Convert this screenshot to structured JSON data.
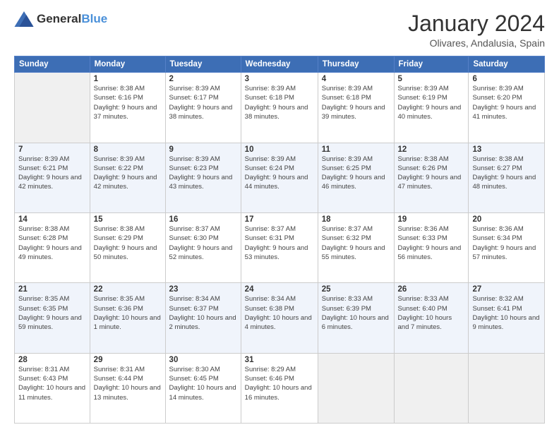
{
  "logo": {
    "general": "General",
    "blue": "Blue"
  },
  "header": {
    "month": "January 2024",
    "location": "Olivares, Andalusia, Spain"
  },
  "weekdays": [
    "Sunday",
    "Monday",
    "Tuesday",
    "Wednesday",
    "Thursday",
    "Friday",
    "Saturday"
  ],
  "weeks": [
    [
      {
        "day": "",
        "empty": true
      },
      {
        "day": "1",
        "sunrise": "8:38 AM",
        "sunset": "6:16 PM",
        "daylight": "9 hours and 37 minutes."
      },
      {
        "day": "2",
        "sunrise": "8:39 AM",
        "sunset": "6:17 PM",
        "daylight": "9 hours and 38 minutes."
      },
      {
        "day": "3",
        "sunrise": "8:39 AM",
        "sunset": "6:18 PM",
        "daylight": "9 hours and 38 minutes."
      },
      {
        "day": "4",
        "sunrise": "8:39 AM",
        "sunset": "6:18 PM",
        "daylight": "9 hours and 39 minutes."
      },
      {
        "day": "5",
        "sunrise": "8:39 AM",
        "sunset": "6:19 PM",
        "daylight": "9 hours and 40 minutes."
      },
      {
        "day": "6",
        "sunrise": "8:39 AM",
        "sunset": "6:20 PM",
        "daylight": "9 hours and 41 minutes."
      }
    ],
    [
      {
        "day": "7",
        "sunrise": "8:39 AM",
        "sunset": "6:21 PM",
        "daylight": "9 hours and 42 minutes."
      },
      {
        "day": "8",
        "sunrise": "8:39 AM",
        "sunset": "6:22 PM",
        "daylight": "9 hours and 42 minutes."
      },
      {
        "day": "9",
        "sunrise": "8:39 AM",
        "sunset": "6:23 PM",
        "daylight": "9 hours and 43 minutes."
      },
      {
        "day": "10",
        "sunrise": "8:39 AM",
        "sunset": "6:24 PM",
        "daylight": "9 hours and 44 minutes."
      },
      {
        "day": "11",
        "sunrise": "8:39 AM",
        "sunset": "6:25 PM",
        "daylight": "9 hours and 46 minutes."
      },
      {
        "day": "12",
        "sunrise": "8:38 AM",
        "sunset": "6:26 PM",
        "daylight": "9 hours and 47 minutes."
      },
      {
        "day": "13",
        "sunrise": "8:38 AM",
        "sunset": "6:27 PM",
        "daylight": "9 hours and 48 minutes."
      }
    ],
    [
      {
        "day": "14",
        "sunrise": "8:38 AM",
        "sunset": "6:28 PM",
        "daylight": "9 hours and 49 minutes."
      },
      {
        "day": "15",
        "sunrise": "8:38 AM",
        "sunset": "6:29 PM",
        "daylight": "9 hours and 50 minutes."
      },
      {
        "day": "16",
        "sunrise": "8:37 AM",
        "sunset": "6:30 PM",
        "daylight": "9 hours and 52 minutes."
      },
      {
        "day": "17",
        "sunrise": "8:37 AM",
        "sunset": "6:31 PM",
        "daylight": "9 hours and 53 minutes."
      },
      {
        "day": "18",
        "sunrise": "8:37 AM",
        "sunset": "6:32 PM",
        "daylight": "9 hours and 55 minutes."
      },
      {
        "day": "19",
        "sunrise": "8:36 AM",
        "sunset": "6:33 PM",
        "daylight": "9 hours and 56 minutes."
      },
      {
        "day": "20",
        "sunrise": "8:36 AM",
        "sunset": "6:34 PM",
        "daylight": "9 hours and 57 minutes."
      }
    ],
    [
      {
        "day": "21",
        "sunrise": "8:35 AM",
        "sunset": "6:35 PM",
        "daylight": "9 hours and 59 minutes."
      },
      {
        "day": "22",
        "sunrise": "8:35 AM",
        "sunset": "6:36 PM",
        "daylight": "10 hours and 1 minute."
      },
      {
        "day": "23",
        "sunrise": "8:34 AM",
        "sunset": "6:37 PM",
        "daylight": "10 hours and 2 minutes."
      },
      {
        "day": "24",
        "sunrise": "8:34 AM",
        "sunset": "6:38 PM",
        "daylight": "10 hours and 4 minutes."
      },
      {
        "day": "25",
        "sunrise": "8:33 AM",
        "sunset": "6:39 PM",
        "daylight": "10 hours and 6 minutes."
      },
      {
        "day": "26",
        "sunrise": "8:33 AM",
        "sunset": "6:40 PM",
        "daylight": "10 hours and 7 minutes."
      },
      {
        "day": "27",
        "sunrise": "8:32 AM",
        "sunset": "6:41 PM",
        "daylight": "10 hours and 9 minutes."
      }
    ],
    [
      {
        "day": "28",
        "sunrise": "8:31 AM",
        "sunset": "6:43 PM",
        "daylight": "10 hours and 11 minutes."
      },
      {
        "day": "29",
        "sunrise": "8:31 AM",
        "sunset": "6:44 PM",
        "daylight": "10 hours and 13 minutes."
      },
      {
        "day": "30",
        "sunrise": "8:30 AM",
        "sunset": "6:45 PM",
        "daylight": "10 hours and 14 minutes."
      },
      {
        "day": "31",
        "sunrise": "8:29 AM",
        "sunset": "6:46 PM",
        "daylight": "10 hours and 16 minutes."
      },
      {
        "day": "",
        "empty": true
      },
      {
        "day": "",
        "empty": true
      },
      {
        "day": "",
        "empty": true
      }
    ]
  ]
}
